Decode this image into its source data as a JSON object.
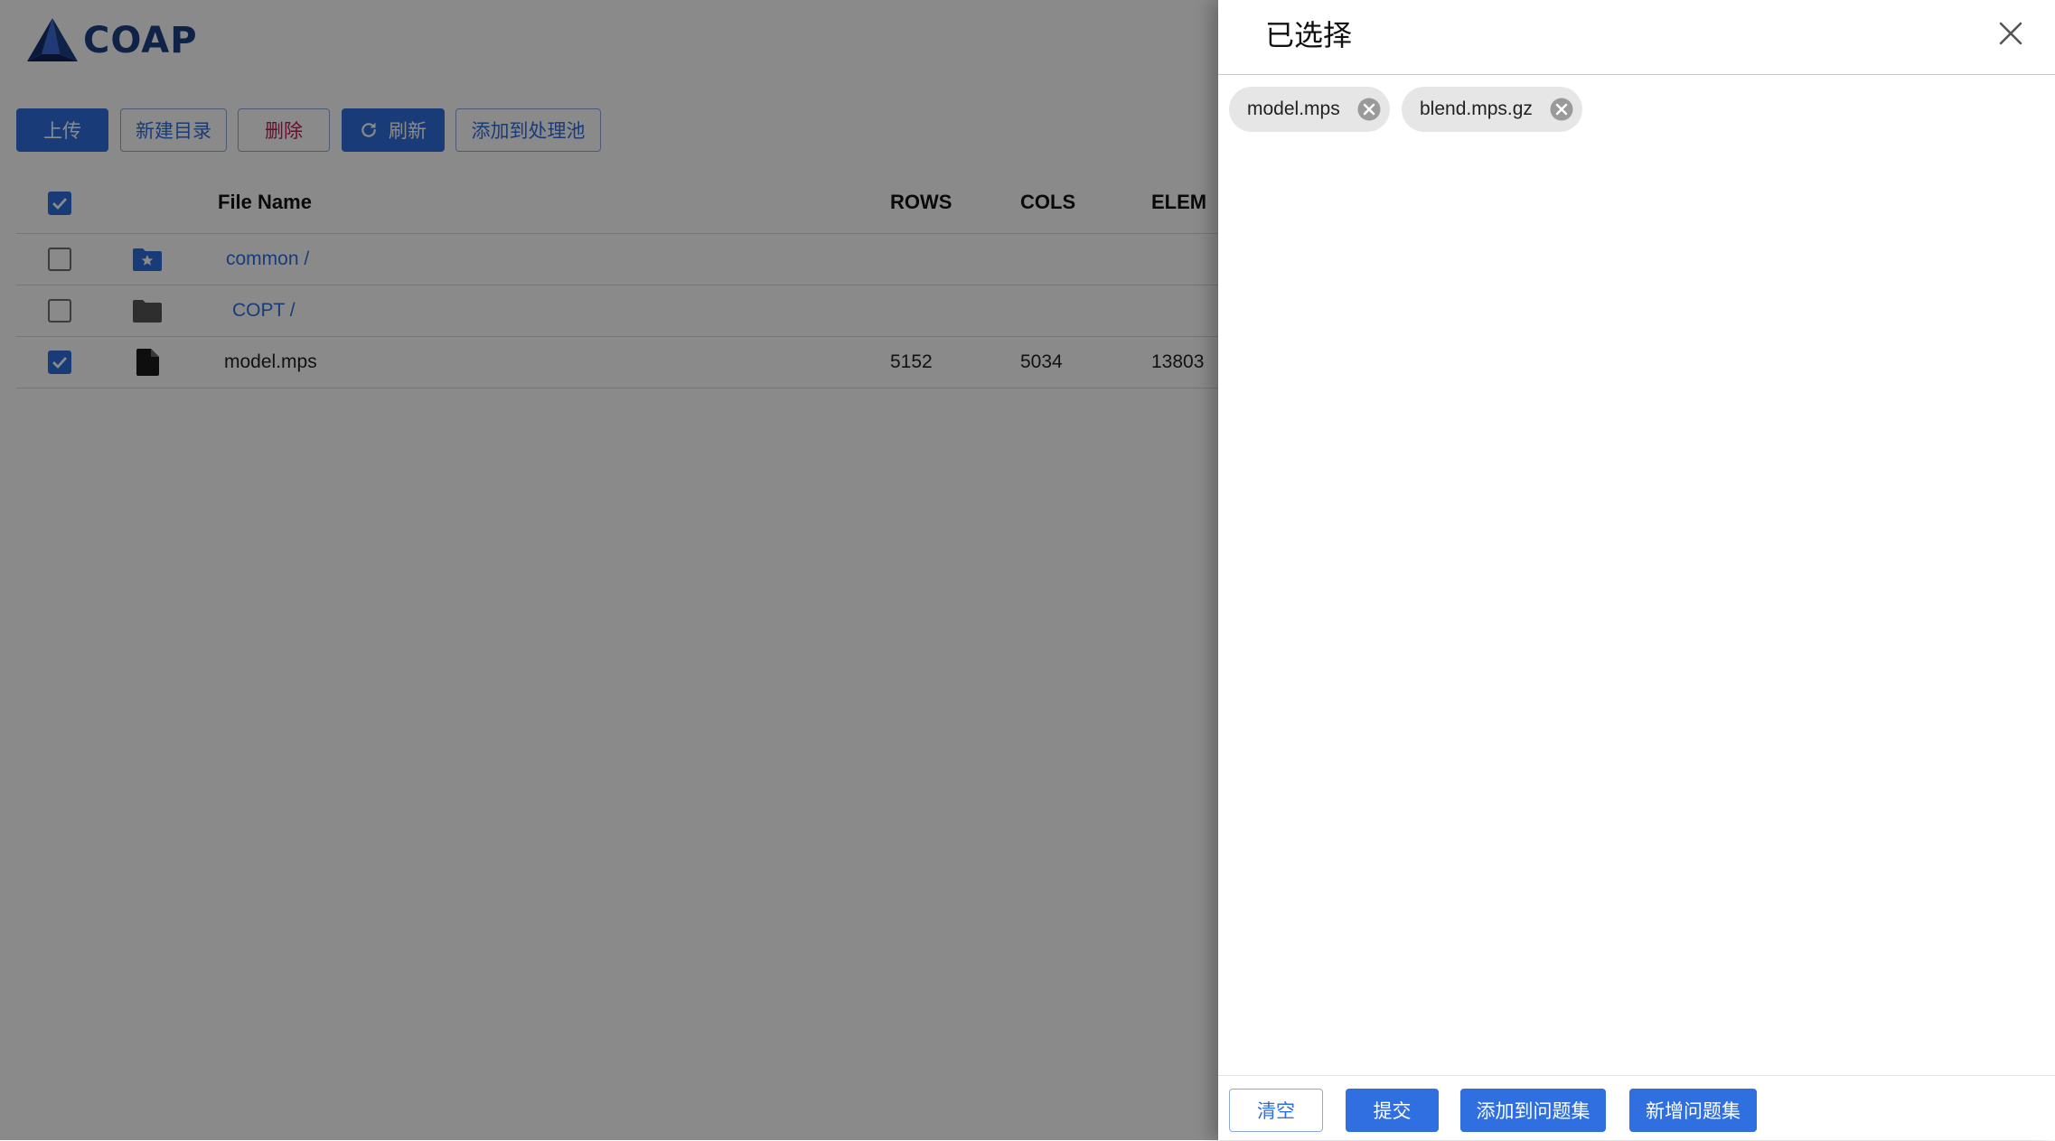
{
  "logo": {
    "text": "COAP"
  },
  "toolbar": {
    "upload": "上传",
    "new_dir": "新建目录",
    "delete": "删除",
    "refresh": "刷新",
    "add_to_pool": "添加到处理池"
  },
  "table": {
    "headers": {
      "file_name": "File Name",
      "rows": "ROWS",
      "cols": "COLS",
      "elem": "ELEM"
    },
    "rows": [
      {
        "name": "common /",
        "type": "starred-folder",
        "checked": false,
        "rows": "",
        "cols": "",
        "elem": ""
      },
      {
        "name": "COPT /",
        "type": "folder",
        "checked": false,
        "rows": "",
        "cols": "",
        "elem": ""
      },
      {
        "name": "model.mps",
        "type": "file",
        "checked": true,
        "rows": "5152",
        "cols": "5034",
        "elem": "13803"
      }
    ]
  },
  "drawer": {
    "title": "已选择",
    "chips": [
      "model.mps",
      "blend.mps.gz"
    ],
    "footer": {
      "clear": "清空",
      "submit": "提交",
      "add_to_set": "添加到问题集",
      "new_set": "新增问题集"
    }
  },
  "colors": {
    "primary": "#2f6fe0",
    "danger": "#c2185b",
    "logo": "#1d3f86",
    "overlay": "rgba(0,0,0,0.46)"
  },
  "icons": {
    "refresh": "refresh-icon",
    "close": "close-icon",
    "chip_remove": "circle-x-icon",
    "starred_folder": "folder-star-icon",
    "folder": "folder-icon",
    "file": "file-icon",
    "check": "check-icon"
  }
}
